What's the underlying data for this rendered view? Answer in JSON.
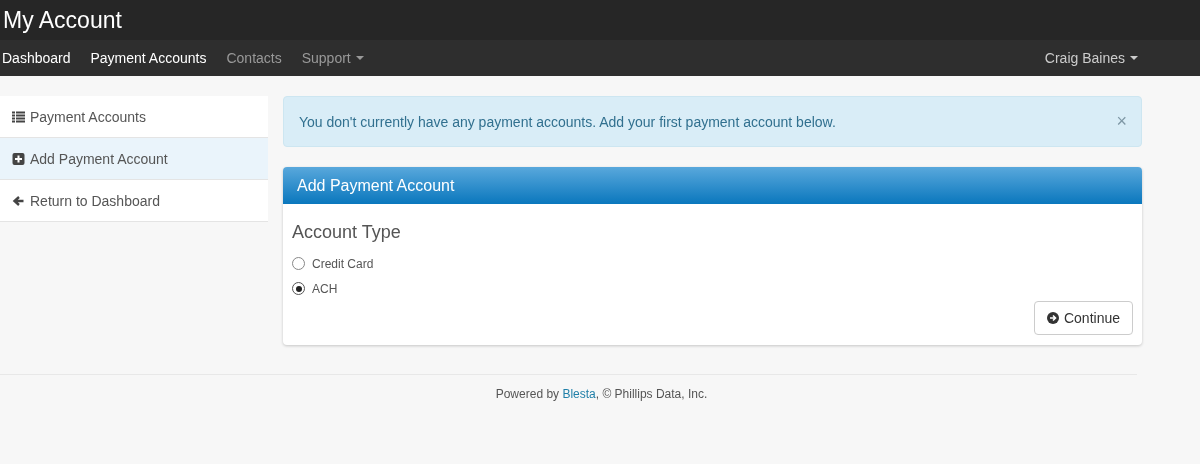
{
  "header": {
    "title": "My Account"
  },
  "nav": [
    {
      "label": "Dashboard",
      "active": true,
      "dropdown": false
    },
    {
      "label": "Payment Accounts",
      "active": true,
      "dropdown": false
    },
    {
      "label": "Contacts",
      "active": false,
      "dropdown": false
    },
    {
      "label": "Support",
      "active": false,
      "dropdown": true
    }
  ],
  "user_menu": {
    "label": "Craig Baines"
  },
  "sidebar": {
    "items": [
      {
        "label": "Payment Accounts",
        "kind": "list",
        "selected": false
      },
      {
        "label": "Add Payment Account",
        "kind": "plus",
        "selected": true
      },
      {
        "label": "Return to Dashboard",
        "kind": "back",
        "selected": false
      }
    ]
  },
  "alert": {
    "message": "You don't currently have any payment accounts. Add your first payment account below.",
    "close": "×"
  },
  "panel": {
    "title": "Add Payment Account",
    "section": "Account Type",
    "options": [
      {
        "label": "Credit Card",
        "selected": false
      },
      {
        "label": "ACH",
        "selected": true
      }
    ],
    "button": "Continue"
  },
  "footer": {
    "prefix": "Powered by ",
    "link": "Blesta",
    "suffix": ", © Phillips Data, Inc."
  }
}
